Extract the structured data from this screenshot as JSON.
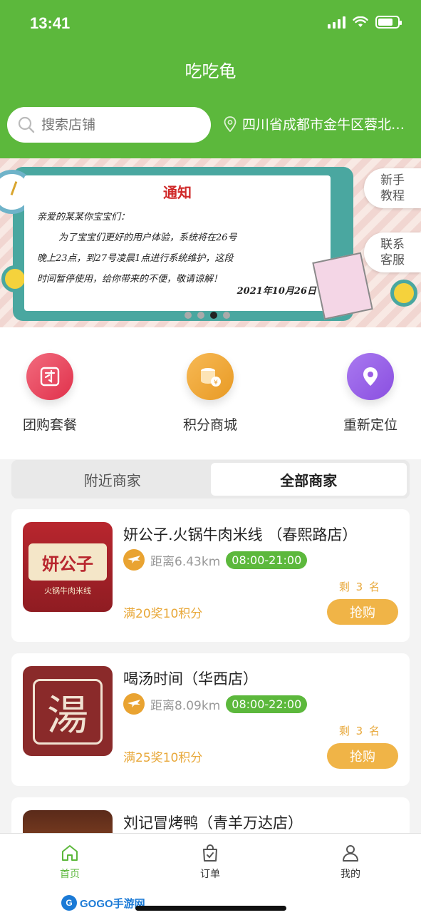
{
  "status_bar": {
    "time": "13:41"
  },
  "header": {
    "title": "吃吃龟",
    "search_placeholder": "搜索店铺",
    "location": "四川省成都市金牛区蓉北…"
  },
  "banner": {
    "notice_title": "通知",
    "lines": [
      "亲爱的某某你宝宝们：",
      "为了宝宝们更好的用户体验，系统将在26号",
      "晚上23点，到27号凌晨1点进行系统维护，这段",
      "时间暂停使用，给你带来的不便，敬请谅解！"
    ],
    "date": "2021年10月26日",
    "side_buttons": [
      "新手\n教程",
      "联系\n客服"
    ],
    "active_dot": 3,
    "dot_count": 4
  },
  "quick_menu": [
    {
      "label": "团购套餐",
      "icon": "group-buy-icon",
      "color": "#e8455c"
    },
    {
      "label": "积分商城",
      "icon": "coins-icon",
      "color": "#f0a33a"
    },
    {
      "label": "重新定位",
      "icon": "location-pin-icon",
      "color": "#9b5de5"
    }
  ],
  "tabs": {
    "nearby": "附近商家",
    "all": "全部商家",
    "active": "all"
  },
  "stores": [
    {
      "name": "妍公子.火锅牛肉米线 （春熙路店）",
      "distance": "距离6.43km",
      "hours": "08:00-21:00",
      "remain": "剩 3 名",
      "promo": "满20奖10积分",
      "buy": "抢购",
      "logo_text": "妍公子",
      "logo_sub": "火锅牛肉米线"
    },
    {
      "name": "喝汤时间（华西店）",
      "distance": "距离8.09km",
      "hours": "08:00-22:00",
      "remain": "剩 3 名",
      "promo": "满25奖10积分",
      "buy": "抢购",
      "logo_text": "湯"
    },
    {
      "name": "刘记冒烤鸭（青羊万达店）"
    }
  ],
  "tabbar": {
    "home": "首页",
    "orders": "订单",
    "mine": "我的"
  },
  "watermark": "GOGO手游网"
}
